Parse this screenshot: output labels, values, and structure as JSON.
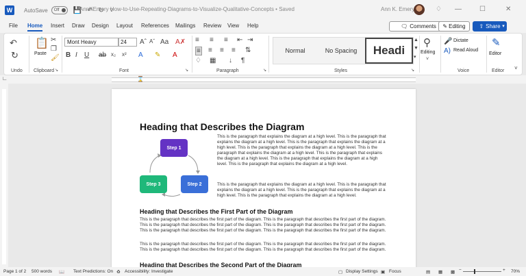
{
  "titlebar": {
    "autosave_label": "AutoSave",
    "autosave_state": "Off",
    "doc_title": "AnnKEmery How-to-Use-Repeating-Diagrams-to-Visualize-Qualitative-Concepts • Saved",
    "user_name": "Ann K. Emery"
  },
  "tabs": [
    "File",
    "Home",
    "Insert",
    "Draw",
    "Design",
    "Layout",
    "References",
    "Mailings",
    "Review",
    "View",
    "Help"
  ],
  "active_tab": "Home",
  "top_buttons": {
    "comments": "Comments",
    "editing": "Editing",
    "share": "Share"
  },
  "ribbon": {
    "groups": {
      "undo": "Undo",
      "clipboard": "Clipboard",
      "font": "Font",
      "paragraph": "Paragraph",
      "styles": "Styles",
      "voice": "Voice",
      "editor": "Editor"
    },
    "paste_label": "Paste",
    "font_name": "Mont Heavy",
    "font_size": "24",
    "styles": {
      "normal": "Normal",
      "no_spacing": "No Spacing",
      "heading": "Headi"
    },
    "editing_label": "Editing",
    "dictate_label": "Dictate",
    "read_aloud_label": "Read Aloud",
    "editor_label": "Editor"
  },
  "document": {
    "heading": "Heading that Describes the Diagram",
    "intro_para_1": "This is the paragraph that explains the diagram at a high level. This is the paragraph that explains the diagram at a high level. This is the paragraph that explains the diagram at a high level. This is the paragraph that explains the diagram at a high level. This is the paragraph that explains the diagram at a high level. This is the paragraph that explains the diagram at a high level. This is the paragraph that explains the diagram at a high level. This is the paragraph that explains the diagram at a high level.",
    "intro_para_2": "This is the paragraph that explains the diagram at a high level. This is the paragraph that explains the diagram at a high level. This is the paragraph that explains the diagram at a high level. This is the paragraph that explains the diagram at a high level.",
    "steps": [
      "Step 1",
      "Step 2",
      "Step 3"
    ],
    "step_colors": [
      "#6433c4",
      "#3a6fd8",
      "#1fb87a"
    ],
    "subheading_1": "Heading that Describes the First Part of the Diagram",
    "part1_para_1": "This is the paragraph that describes the first part of the diagram. This is the paragraph that describes the first part of the diagram. This is the paragraph that describes the first part of the diagram. This is the paragraph that describes the first part of the diagram. This is the paragraph that describes the first part of the diagram. This is the paragraph that describes the first part of the diagram.",
    "part1_para_2": "This is the paragraph that describes the first part of the diagram. This is the paragraph that describes the first part of the diagram. This is the paragraph that describes the first part of the diagram. This is the paragraph that describes the first part of the diagram.",
    "subheading_2": "Heading that Describes the Second Part of the Diagram"
  },
  "statusbar": {
    "page": "Page 1 of 2",
    "words": "500 words",
    "text_predictions": "Text Predictions: On",
    "accessibility": "Accessibility: Investigate",
    "display_settings": "Display Settings",
    "focus": "Focus",
    "zoom": "70%"
  }
}
